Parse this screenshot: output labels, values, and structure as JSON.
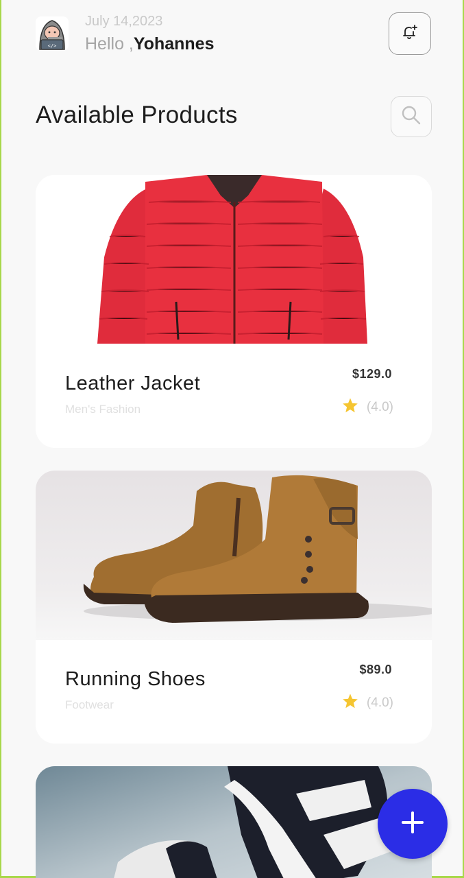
{
  "header": {
    "date": "July 14,2023",
    "greeting": "Hello ,",
    "user_name": "Yohannes"
  },
  "page_title": "Available Products",
  "products": [
    {
      "name": "Leather Jacket",
      "category": "Men's Fashion",
      "price": "$129.0",
      "rating": "(4.0)",
      "image": "red-puffer-jacket-image"
    },
    {
      "name": "Running Shoes",
      "category": "Footwear",
      "price": "$89.0",
      "rating": "(4.0)",
      "image": "brown-leather-boots-image"
    },
    {
      "image": "black-white-sneakers-image"
    }
  ],
  "colors": {
    "accent": "#2b2de6",
    "star": "#f5c531",
    "jacket": "#e8303f",
    "boot": "#a87432"
  },
  "icons": {
    "notification": "bell-plus-icon",
    "search": "search-icon",
    "add": "plus-icon"
  }
}
